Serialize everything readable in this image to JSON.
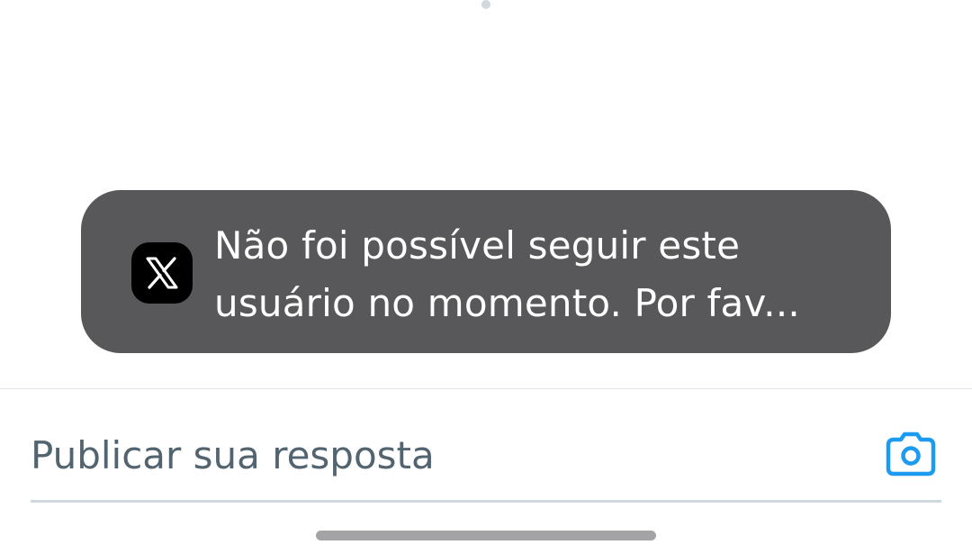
{
  "toast": {
    "app_icon": "x-logo-icon",
    "message_line1": "Não foi possível seguir este",
    "message_line2": "usuário no momento. Por fav..."
  },
  "reply": {
    "placeholder": "Publicar sua resposta",
    "camera_icon": "camera-icon"
  },
  "colors": {
    "accent": "#1d9bf0",
    "toast_bg": "#58585a",
    "placeholder": "#536471"
  }
}
